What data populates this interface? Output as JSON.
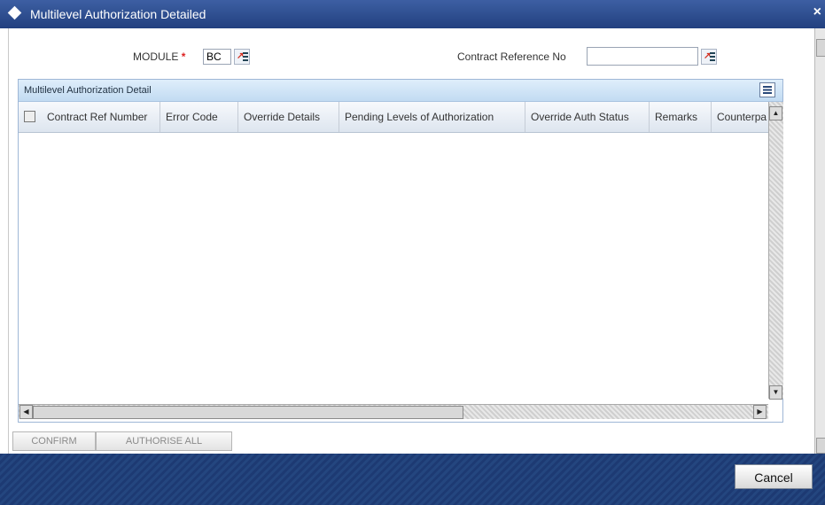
{
  "window": {
    "title": "Multilevel Authorization Detailed",
    "close_glyph": "×"
  },
  "form": {
    "module_label": "MODULE",
    "required_mark": "*",
    "module_value": "BC",
    "contract_ref_label": "Contract Reference No",
    "contract_ref_value": ""
  },
  "grid": {
    "title": "Multilevel Authorization Detail",
    "columns": [
      "Contract Ref Number",
      "Error Code",
      "Override Details",
      "Pending Levels of Authorization",
      "Override Auth Status",
      "Remarks",
      "Counterpa"
    ],
    "rows": []
  },
  "actions": {
    "confirm_label": "CONFIRM",
    "authorise_all_label": "AUTHORISE ALL"
  },
  "footer": {
    "cancel_label": "Cancel"
  },
  "icons": {
    "lov": "list-of-values-icon",
    "grid_menu": "list-view-icon"
  }
}
